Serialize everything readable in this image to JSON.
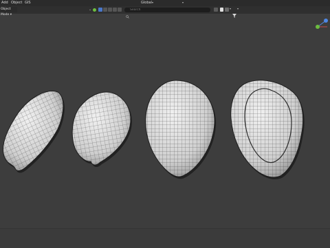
{
  "menubar": {
    "items": [
      {
        "label": "Add"
      },
      {
        "label": "Object"
      },
      {
        "label": "GIS"
      }
    ]
  },
  "header": {
    "transform_orientation": "Global"
  },
  "toolbar": {
    "mode_label": "Object Mode",
    "search_placeholder": "Search"
  },
  "colors": {
    "viewport_bg": "#3d3d3d",
    "mesh_fill": "#dcdcdc",
    "wire": "#2a2a2a",
    "active_button": "#4a77c9",
    "gizmo_y": "#6cbd3f",
    "gizmo_z": "#4f88e6"
  }
}
